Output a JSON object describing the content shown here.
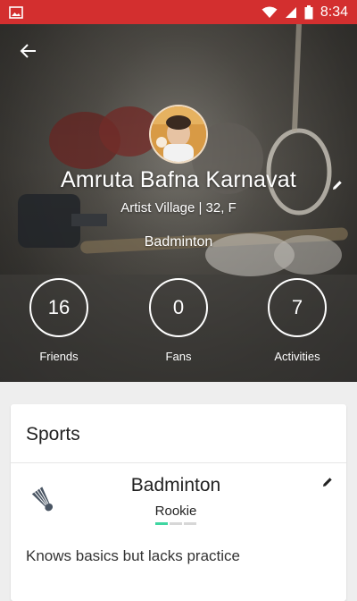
{
  "status_bar": {
    "time": "8:34",
    "icons": [
      "gallery-icon",
      "wifi-icon",
      "signal-icon",
      "battery-icon"
    ]
  },
  "profile": {
    "name": "Amruta Bafna Karnavat",
    "subtitle": "Artist Village | 32, F",
    "sport": "Badminton"
  },
  "stats": [
    {
      "value": "16",
      "label": "Friends"
    },
    {
      "value": "0",
      "label": "Fans"
    },
    {
      "value": "7",
      "label": "Activities"
    }
  ],
  "sports_card": {
    "title": "Sports",
    "item": {
      "name": "Badminton",
      "level": "Rookie",
      "level_filled": 1,
      "level_total": 3,
      "description": "Knows basics but lacks practice"
    }
  },
  "colors": {
    "status_bar": "#d32f2f",
    "level_accent": "#3fd6a1",
    "background": "#eeeeee"
  }
}
